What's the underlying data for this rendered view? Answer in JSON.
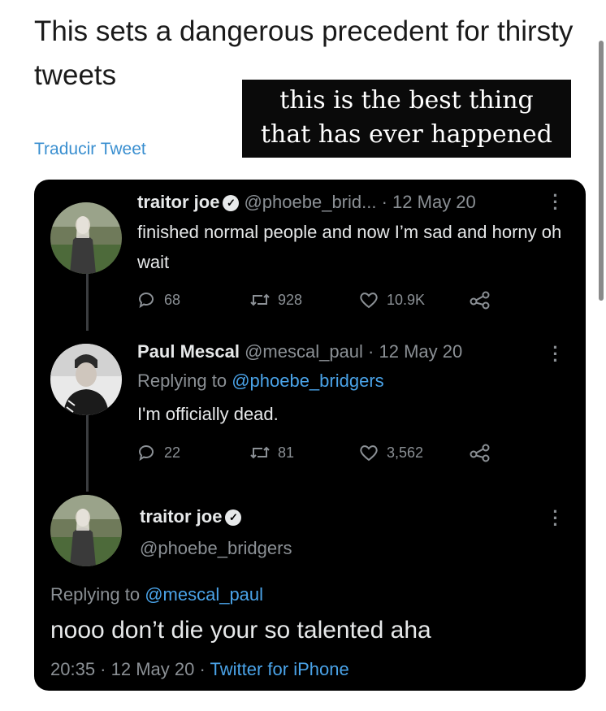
{
  "headline": "This sets a dangerous precedent for thirsty tweets",
  "translate_link": "Traducir Tweet",
  "overlay_caption": {
    "line1": "this is the best thing",
    "line2": "that has ever happened"
  },
  "tweet1": {
    "name": "traitor joe",
    "handle": "@phoebe_brid...",
    "separator": " · ",
    "date": "12 May 20",
    "text": "finished normal people and now I’m sad and horny oh wait",
    "replies": "68",
    "retweets": "928",
    "likes": "10.9K"
  },
  "tweet2": {
    "name": "Paul Mescal",
    "handle": "@mescal_paul",
    "separator": " · ",
    "date": "12 May 20",
    "replying_prefix": "Replying to ",
    "replying_to": "@phoebe_bridgers",
    "text": "I'm officially dead.",
    "replies": "22",
    "retweets": "81",
    "likes": "3,562"
  },
  "tweet3": {
    "name": "traitor joe",
    "handle": "@phoebe_bridgers",
    "replying_prefix": "Replying to ",
    "replying_to": "@mescal_paul",
    "text": "nooo don’t die your so talented aha",
    "time": "20:35",
    "separator": " · ",
    "date": "12 May 20",
    "source": "Twitter for iPhone"
  },
  "colors": {
    "card_bg": "#000000",
    "link": "#4aa3e8",
    "muted": "#8b9095",
    "translate": "#3a8fd0"
  }
}
